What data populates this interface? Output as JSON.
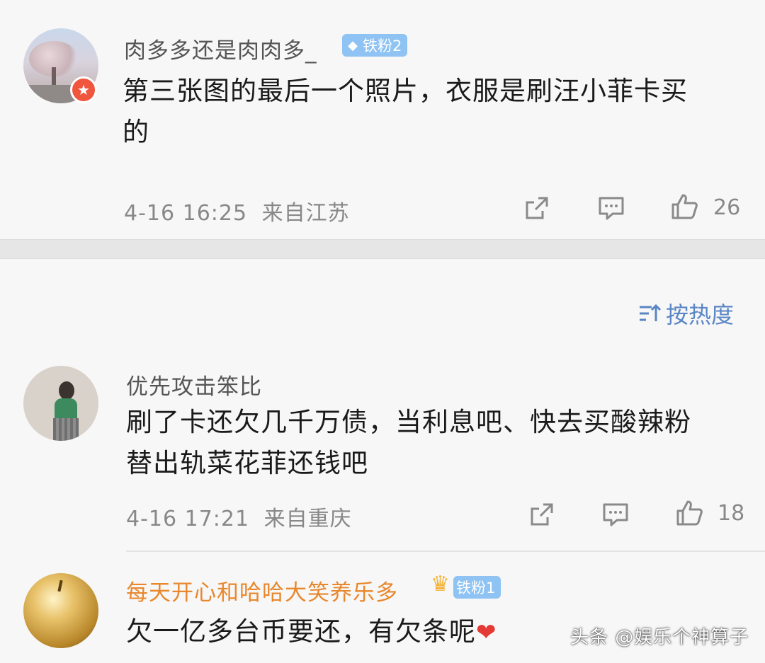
{
  "comments": [
    {
      "username": "肉多多还是肉肉多_",
      "fan_badge": "铁粉2",
      "text_line1": "第三张图的最后一个照片，衣服是刷汪小菲卡买",
      "text_line2": "的",
      "time": "4-16 16:25",
      "location": "来自江苏",
      "likes": "26"
    },
    {
      "username": "优先攻击笨比",
      "text_line1": "刷了卡还欠几千万债，当利息吧、快去买酸辣粉",
      "text_line2": "替出轨菜花菲还钱吧",
      "time": "4-16 17:21",
      "location": "来自重庆",
      "likes": "18"
    },
    {
      "username": "每天开心和哈哈大笑养乐多",
      "fan_badge": "铁粉1",
      "text_line1": "欠一亿多台币要还，有欠条呢",
      "heart": "❤"
    }
  ],
  "sort": {
    "label": "按热度"
  },
  "watermark": "头条 @娱乐个神算子",
  "colors": {
    "gold_name": "#e8872c",
    "fan_badge": "#8ec3f3",
    "sort": "#5a86c5"
  }
}
